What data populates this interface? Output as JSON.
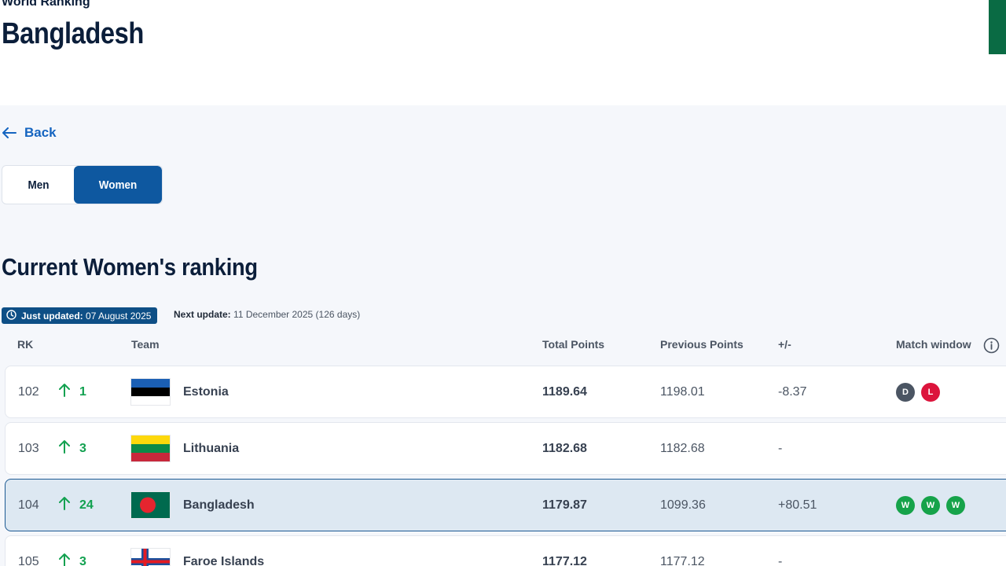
{
  "header": {
    "kicker": "World Ranking",
    "title": "Bangladesh"
  },
  "nav": {
    "back_label": "Back"
  },
  "toggle": {
    "men_label": "Men",
    "women_label": "Women",
    "selected": "Women"
  },
  "section": {
    "title": "Current Women's ranking"
  },
  "update": {
    "just_updated_label": "Just updated:",
    "just_updated_date": "07 August 2025",
    "next_update_label": "Next update:",
    "next_update_value": "11 December 2025 (126 days)"
  },
  "table": {
    "headers": {
      "rank": "RK",
      "team": "Team",
      "total": "Total Points",
      "previous": "Previous Points",
      "diff": "+/-",
      "window": "Match window"
    },
    "rows": [
      {
        "rank": "102",
        "move": "1",
        "team": "Estonia",
        "flag": "estonia",
        "total": "1189.64",
        "previous": "1198.01",
        "diff": "-8.37",
        "window": [
          "D",
          "L"
        ]
      },
      {
        "rank": "103",
        "move": "3",
        "team": "Lithuania",
        "flag": "lithuania",
        "total": "1182.68",
        "previous": "1182.68",
        "diff": "-",
        "window": []
      },
      {
        "rank": "104",
        "move": "24",
        "team": "Bangladesh",
        "flag": "bangladesh",
        "total": "1179.87",
        "previous": "1099.36",
        "diff": "+80.51",
        "window": [
          "W",
          "W",
          "W"
        ]
      },
      {
        "rank": "105",
        "move": "3",
        "team": "Faroe Islands",
        "flag": "faroe-islands",
        "total": "1177.12",
        "previous": "1177.12",
        "diff": "-",
        "window": []
      }
    ]
  },
  "colors": {
    "brand_blue": "#0e58a0",
    "up_green": "#12a150",
    "win": "#16a34a",
    "draw": "#4b5563",
    "loss": "#dc143c",
    "accent_green": "#0a6b44"
  }
}
